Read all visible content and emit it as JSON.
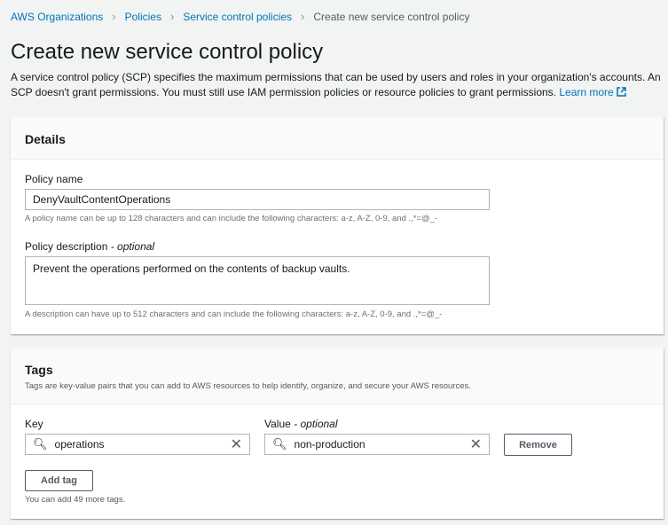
{
  "breadcrumb": [
    "AWS Organizations",
    "Policies",
    "Service control policies",
    "Create new service control policy"
  ],
  "page": {
    "title": "Create new service control policy",
    "description": "A service control policy (SCP) specifies the maximum permissions that can be used by users and roles in your organization's accounts. An SCP doesn't grant permissions. You must still use IAM permission policies or resource policies to grant permissions.",
    "learn_more": "Learn more"
  },
  "details": {
    "title": "Details",
    "name_label": "Policy name",
    "name_value": "DenyVaultContentOperations",
    "name_hint": "A policy name can be up to 128 characters and can include the following characters: a-z, A-Z, 0-9, and .,*=@_-",
    "desc_label": "Policy description",
    "optional": "- optional",
    "desc_value": "Prevent the operations performed on the contents of backup vaults.",
    "desc_hint": "A description can have up to 512 characters and can include the following characters: a-z, A-Z, 0-9, and .,*=@_-"
  },
  "tags": {
    "title": "Tags",
    "subtitle": "Tags are key-value pairs that you can add to AWS resources to help identify, organize, and secure your AWS resources.",
    "key_label": "Key",
    "value_label": "Value",
    "optional": "- optional",
    "key_value": "operations",
    "value_value": "non-production",
    "remove": "Remove",
    "add_tag": "Add tag",
    "hint": "You can add 49 more tags."
  }
}
